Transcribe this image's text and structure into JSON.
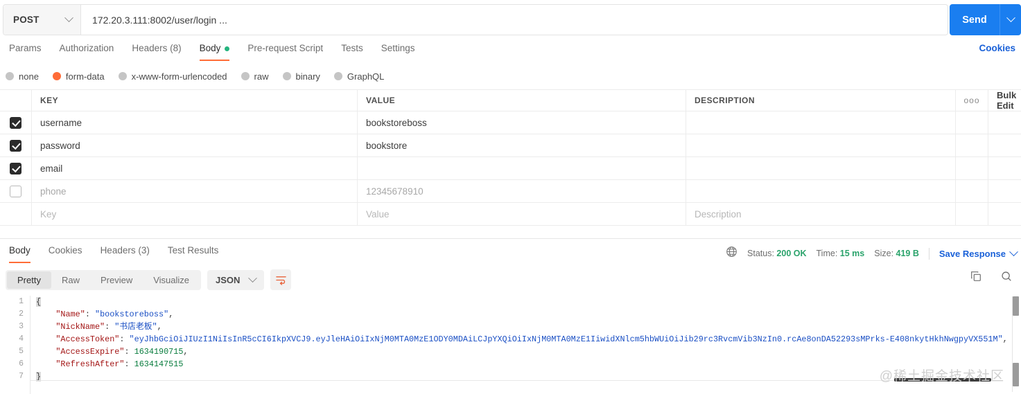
{
  "request": {
    "method": "POST",
    "url": "172.20.3.111:8002/user/login ...",
    "send_label": "Send",
    "cookies_label": "Cookies",
    "tabs": [
      {
        "label": "Params",
        "active": false,
        "dot": false
      },
      {
        "label": "Authorization",
        "active": false,
        "dot": false
      },
      {
        "label": "Headers (8)",
        "active": false,
        "dot": false
      },
      {
        "label": "Body",
        "active": true,
        "dot": true
      },
      {
        "label": "Pre-request Script",
        "active": false,
        "dot": false
      },
      {
        "label": "Tests",
        "active": false,
        "dot": false
      },
      {
        "label": "Settings",
        "active": false,
        "dot": false
      }
    ],
    "body_types": [
      {
        "label": "none",
        "selected": false
      },
      {
        "label": "form-data",
        "selected": true
      },
      {
        "label": "x-www-form-urlencoded",
        "selected": false
      },
      {
        "label": "raw",
        "selected": false
      },
      {
        "label": "binary",
        "selected": false
      },
      {
        "label": "GraphQL",
        "selected": false
      }
    ],
    "table": {
      "headers": {
        "key": "KEY",
        "value": "VALUE",
        "description": "DESCRIPTION"
      },
      "bulk_edit_label": "Bulk Edit",
      "options_icon": "ooo",
      "rows": [
        {
          "checked": true,
          "key": "username",
          "value": "bookstoreboss",
          "description": "",
          "placeholder": false
        },
        {
          "checked": true,
          "key": "password",
          "value": "bookstore",
          "description": "",
          "placeholder": false
        },
        {
          "checked": true,
          "key": "email",
          "value": "",
          "description": "",
          "placeholder": false
        },
        {
          "checked": false,
          "key": "phone",
          "value": "12345678910",
          "description": "",
          "placeholder": true
        }
      ],
      "new_row": {
        "key": "Key",
        "value": "Value",
        "description": "Description"
      }
    }
  },
  "response": {
    "tabs": [
      {
        "label": "Body",
        "active": true
      },
      {
        "label": "Cookies",
        "active": false
      },
      {
        "label": "Headers (3)",
        "active": false
      },
      {
        "label": "Test Results",
        "active": false
      }
    ],
    "headers_count": "(3)",
    "status": {
      "status_label": "Status:",
      "status_value": "200 OK",
      "time_label": "Time:",
      "time_value": "15 ms",
      "size_label": "Size:",
      "size_value": "419 B"
    },
    "save_response_label": "Save Response",
    "format_tabs": [
      {
        "label": "Pretty",
        "active": true
      },
      {
        "label": "Raw",
        "active": false
      },
      {
        "label": "Preview",
        "active": false
      },
      {
        "label": "Visualize",
        "active": false
      }
    ],
    "language": "JSON",
    "body": {
      "line_numbers": [
        "1",
        "2",
        "3",
        "4",
        "5",
        "6",
        "7"
      ],
      "json": {
        "Name": "bookstoreboss",
        "NickName": "书店老板",
        "AccessToken": "eyJhbGciOiJIUzI1NiIsInR5cCI6IkpXVCJ9.eyJleHAiOiIxNjM0MTA0MzE1ODY0MDAiLCJpYXQiOiIxNjM0MTA0MzE1IiwidXNlcm5hbWUiOiJib29rc3RvcmVib3NzIn0.rcAe8onDA52293sMPrks-E408nkytHkhNwgpyVX551M",
        "AccessExpire": 1634190715,
        "RefreshAfter": 1634147515
      }
    }
  },
  "watermark": "@稀土掘金技术社区"
}
